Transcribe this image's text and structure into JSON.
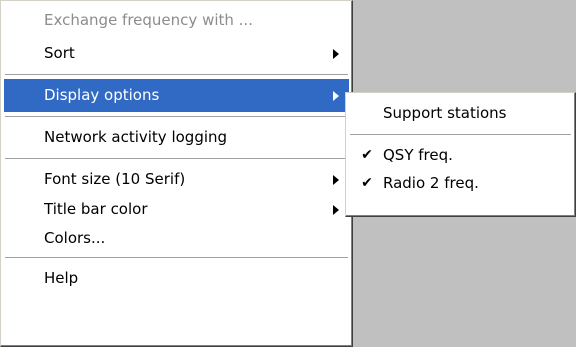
{
  "main_menu": {
    "items": [
      {
        "label": "Exchange frequency with ...",
        "disabled": true
      },
      {
        "label": "Sort",
        "has_submenu": true
      },
      {
        "label": "Display options",
        "has_submenu": true,
        "highlighted": true
      },
      {
        "label": "Network activity logging"
      },
      {
        "label": "Font size (10 Serif)",
        "has_submenu": true
      },
      {
        "label": "Title bar color",
        "has_submenu": true
      },
      {
        "label": "Colors..."
      },
      {
        "label": "Help"
      }
    ]
  },
  "display_options_submenu": {
    "items": [
      {
        "label": "Support stations",
        "checked": false
      },
      {
        "label": "QSY freq.",
        "checked": true
      },
      {
        "label": "Radio 2 freq.",
        "checked": true
      }
    ],
    "check_glyph": "✔"
  },
  "colors": {
    "highlight": "#316ac5",
    "disabled_text": "#8c8c8c",
    "background_gray": "#c0c0c0"
  }
}
